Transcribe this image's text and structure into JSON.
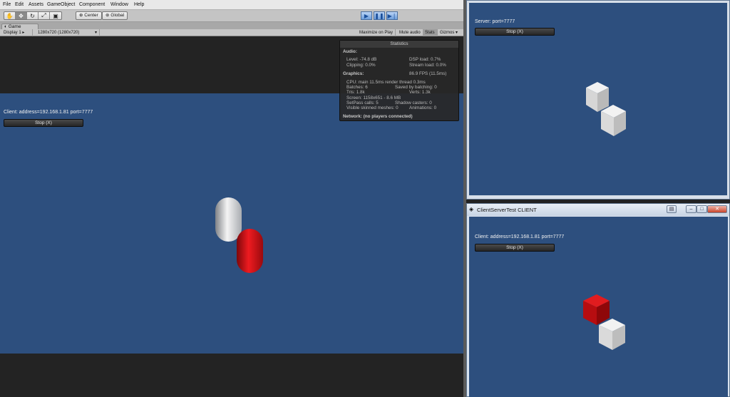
{
  "editor": {
    "menu": [
      "File",
      "Edit",
      "Assets",
      "GameObject",
      "Component",
      "Window",
      "Help"
    ],
    "pivot_center": "Center",
    "pivot_global": "Global",
    "tab_game": "Game",
    "display": "Display 1",
    "resolution": "1280x720 (1280x720)",
    "toggles": [
      "Maximize on Play",
      "Mute audio",
      "Stats",
      "Gizmos"
    ]
  },
  "stats": {
    "title": "Statistics",
    "audio_label": "Audio:",
    "level": "Level: -74.8 dB",
    "dsp": "DSP load: 0.7%",
    "clipping": "Clipping: 0.0%",
    "stream": "Stream load: 0.0%",
    "graphics_label": "Graphics:",
    "fps": "86.9 FPS (11.5ms)",
    "cpu": "CPU: main 11.5ms  render thread 0.3ms",
    "batches": "Batches: 6",
    "saved": "Saved by batching: 0",
    "tris": "Tris: 1.8k",
    "verts": "Verts: 1.3k",
    "screen": "Screen: 1158x651 - 8.6 MB",
    "setpass": "SetPass calls: 5",
    "shadow": "Shadow casters: 0",
    "skinned": "Visible skinned meshes: 0",
    "anim": "Animations: 0",
    "network": "Network: (no players connected)"
  },
  "game": {
    "client_label": "Client: address=192.168.1.81 port=7777",
    "stop_button": "Stop (X)"
  },
  "server_window": {
    "label": "Server: port=7777",
    "stop_button": "Stop (X)"
  },
  "client_window": {
    "title": "ClientServerTest CLIENT",
    "label": "Client: address=192.168.1.81 port=7777",
    "stop_button": "Stop (X)"
  },
  "colors": {
    "scene_blue": "#2d4f7e",
    "red_object": "#d20f14",
    "white_object": "#e8e8e8"
  }
}
